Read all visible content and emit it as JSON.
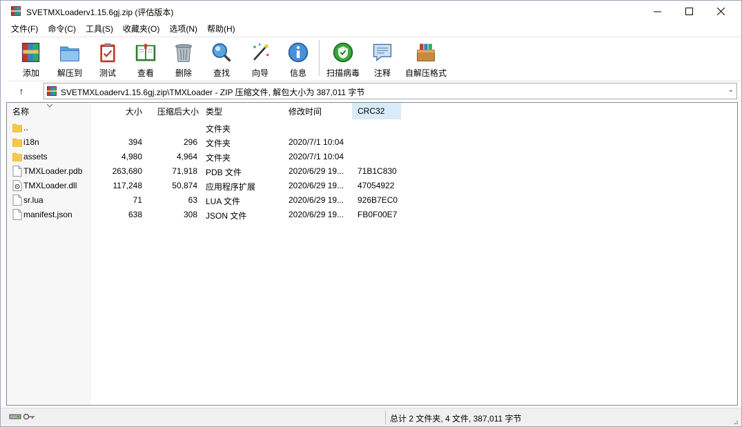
{
  "window": {
    "title": "SVETMXLoaderv1.15.6gj.zip (评估版本)",
    "controls": {
      "minimize": "─",
      "maximize": "☐",
      "close": "✕"
    }
  },
  "menu": [
    "文件(F)",
    "命令(C)",
    "工具(S)",
    "收藏夹(O)",
    "选项(N)",
    "帮助(H)"
  ],
  "toolbar": [
    {
      "label": "添加",
      "icon": "add-archive-icon"
    },
    {
      "label": "解压到",
      "icon": "extract-folder-icon"
    },
    {
      "label": "测试",
      "icon": "test-clipboard-icon"
    },
    {
      "label": "查看",
      "icon": "view-book-icon"
    },
    {
      "label": "删除",
      "icon": "delete-trash-icon"
    },
    {
      "label": "查找",
      "icon": "find-magnifier-icon"
    },
    {
      "label": "向导",
      "icon": "wizard-wand-icon"
    },
    {
      "label": "信息",
      "icon": "info-icon"
    },
    {
      "label": "扫描病毒",
      "icon": "virus-scan-icon"
    },
    {
      "label": "注释",
      "icon": "comment-icon"
    },
    {
      "label": "自解压格式",
      "icon": "sfx-box-icon"
    }
  ],
  "address": {
    "up": "↑",
    "path": "SVETMXLoaderv1.15.6gj.zip\\TMXLoader - ZIP 压缩文件, 解包大小为 387,011 字节",
    "dropdown": "⌄"
  },
  "columns": {
    "name": "名称",
    "size": "大小",
    "packed": "压缩后大小",
    "type": "类型",
    "modified": "修改时间",
    "crc": "CRC32"
  },
  "files": [
    {
      "name": "..",
      "size": "",
      "packed": "",
      "type": "文件夹",
      "modified": "",
      "crc": "",
      "kind": "folder"
    },
    {
      "name": "i18n",
      "size": "394",
      "packed": "296",
      "type": "文件夹",
      "modified": "2020/7/1 10:04",
      "crc": "",
      "kind": "folder"
    },
    {
      "name": "assets",
      "size": "4,980",
      "packed": "4,964",
      "type": "文件夹",
      "modified": "2020/7/1 10:04",
      "crc": "",
      "kind": "folder"
    },
    {
      "name": "TMXLoader.pdb",
      "size": "263,680",
      "packed": "71,918",
      "type": "PDB 文件",
      "modified": "2020/6/29 19...",
      "crc": "71B1C830",
      "kind": "file"
    },
    {
      "name": "TMXLoader.dll",
      "size": "117,248",
      "packed": "50,874",
      "type": "应用程序扩展",
      "modified": "2020/6/29 19...",
      "crc": "47054922",
      "kind": "dll"
    },
    {
      "name": "sr.lua",
      "size": "71",
      "packed": "63",
      "type": "LUA 文件",
      "modified": "2020/6/29 19...",
      "crc": "926B7EC0",
      "kind": "file"
    },
    {
      "name": "manifest.json",
      "size": "638",
      "packed": "308",
      "type": "JSON 文件",
      "modified": "2020/6/29 19...",
      "crc": "FB0F00E7",
      "kind": "file"
    }
  ],
  "status": {
    "summary": "总计 2 文件夹, 4 文件, 387,011 字节"
  }
}
